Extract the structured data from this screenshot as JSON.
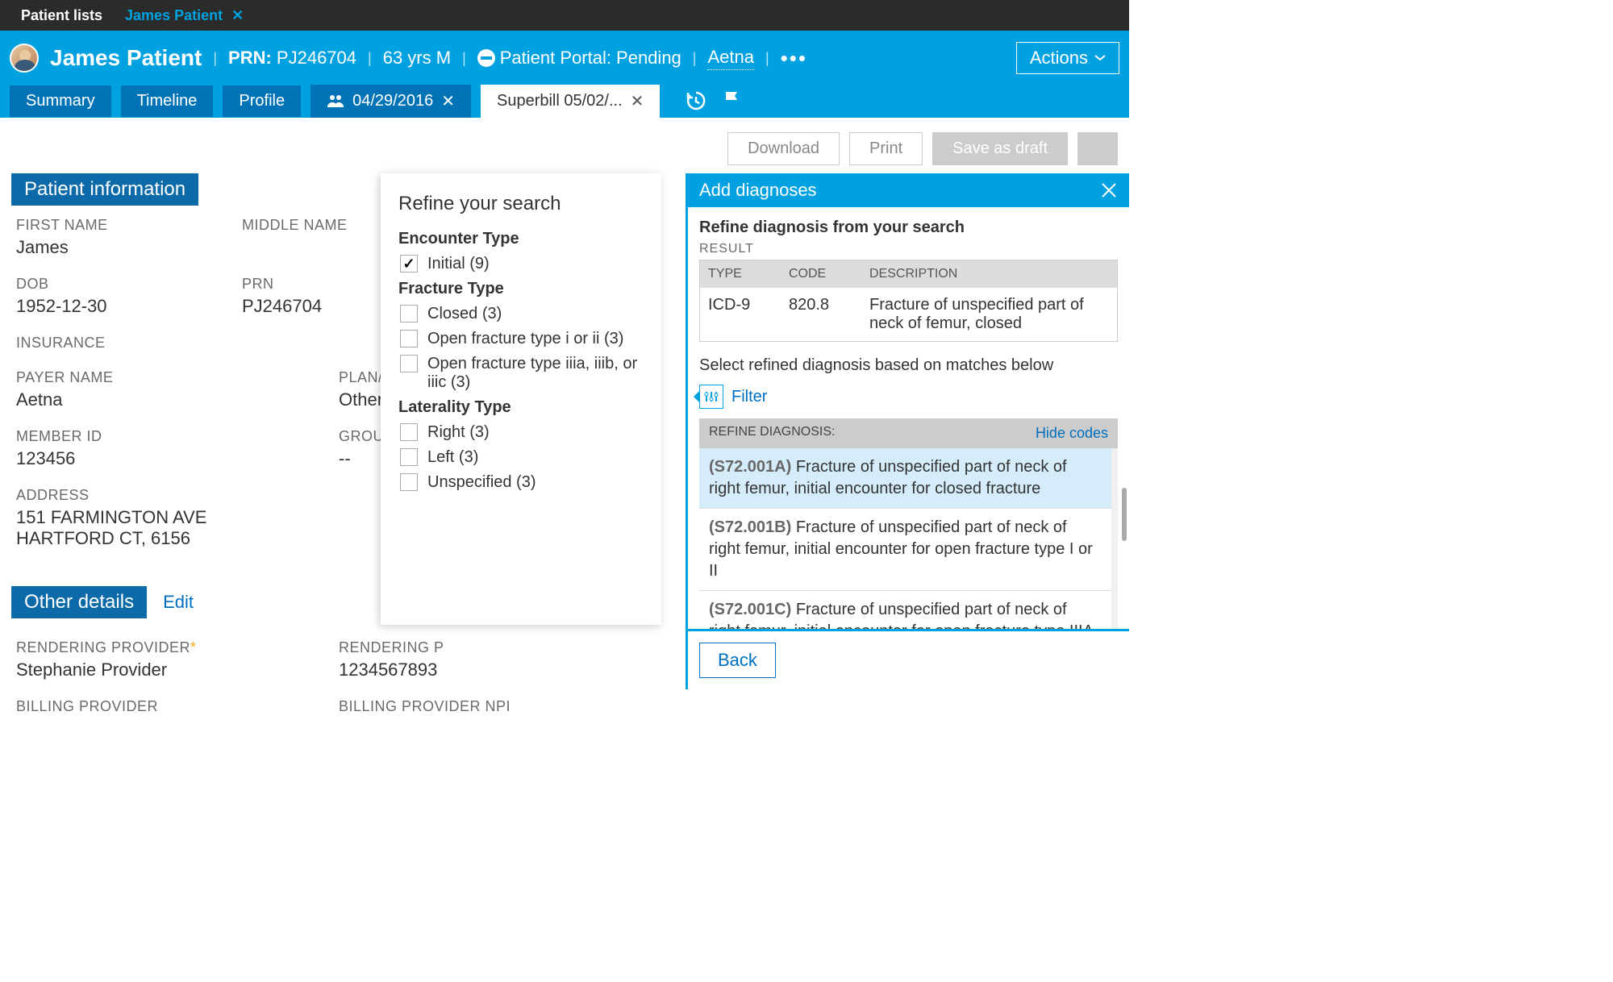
{
  "topbar": {
    "list_tab": "Patient lists",
    "patient_tab": "James Patient"
  },
  "header": {
    "name": "James Patient",
    "prn_label": "PRN:",
    "prn_value": "PJ246704",
    "age_sex": "63 yrs M",
    "portal_status": "Patient Portal: Pending",
    "payer": "Aetna",
    "actions": "Actions"
  },
  "subtabs": {
    "summary": "Summary",
    "timeline": "Timeline",
    "profile": "Profile",
    "encounter_date": "04/29/2016",
    "superbill": "Superbill 05/02/..."
  },
  "toolbar": {
    "download": "Download",
    "print": "Print",
    "save_draft": "Save as draft"
  },
  "sections": {
    "patient_info": "Patient information",
    "other_details": "Other details",
    "edit": "Edit"
  },
  "patient": {
    "first_name_lbl": "FIRST NAME",
    "first_name": "James",
    "middle_name_lbl": "MIDDLE NAME",
    "dob_lbl": "DOB",
    "dob": "1952-12-30",
    "prn_lbl": "PRN",
    "prn": "PJ246704",
    "insurance_lbl": "INSURANCE",
    "payer_name_lbl": "PAYER NAME",
    "payer_name": "Aetna",
    "plan_lbl": "PLAN/TYPE",
    "plan": "Other - Aetna",
    "member_lbl": "MEMBER ID",
    "member": "123456",
    "group_lbl": "GROUP ID",
    "group": "--",
    "address_lbl": "ADDRESS",
    "address1": "151 FARMINGTON AVE",
    "address2": "HARTFORD CT, 6156",
    "rendering_lbl": "RENDERING PROVIDER",
    "rendering": "Stephanie Provider",
    "rendering_npi_lbl": "RENDERING P",
    "rendering_npi": "1234567893",
    "billing_lbl": "BILLING PROVIDER",
    "billing_npi_lbl": "BILLING PROVIDER NPI"
  },
  "refine": {
    "title": "Refine your search",
    "encounter_type": "Encounter Type",
    "initial": "Initial (9)",
    "fracture_type": "Fracture Type",
    "closed": "Closed (3)",
    "open12": "Open fracture type i or ii (3)",
    "open3": "Open fracture type iiia, iiib, or iiic (3)",
    "laterality": "Laterality Type",
    "right": "Right (3)",
    "left": "Left (3)",
    "unspecified": "Unspecified (3)"
  },
  "panel": {
    "title": "Add diagnoses",
    "subtitle": "Refine diagnosis from your search",
    "result_lbl": "RESULT",
    "col_type": "TYPE",
    "col_code": "CODE",
    "col_desc": "DESCRIPTION",
    "res_type": "ICD-9",
    "res_code": "820.8",
    "res_desc": "Fracture of unspecified part of neck of femur, closed",
    "select_text": "Select refined diagnosis based on matches below",
    "filter": "Filter",
    "refine_diag": "REFINE DIAGNOSIS:",
    "hide_codes": "Hide codes",
    "d1_code": "(S72.001A)",
    "d1_txt": " Fracture of unspecified part of neck of right femur, initial encounter for closed fracture",
    "d2_code": "(S72.001B)",
    "d2_txt": " Fracture of unspecified part of neck of right femur, initial encounter for open fracture type I or II",
    "d3_code": "(S72.001C)",
    "d3_txt": " Fracture of unspecified part of neck of right femur, initial encounter for open fracture type IIIA, IIIB,",
    "back": "Back"
  }
}
